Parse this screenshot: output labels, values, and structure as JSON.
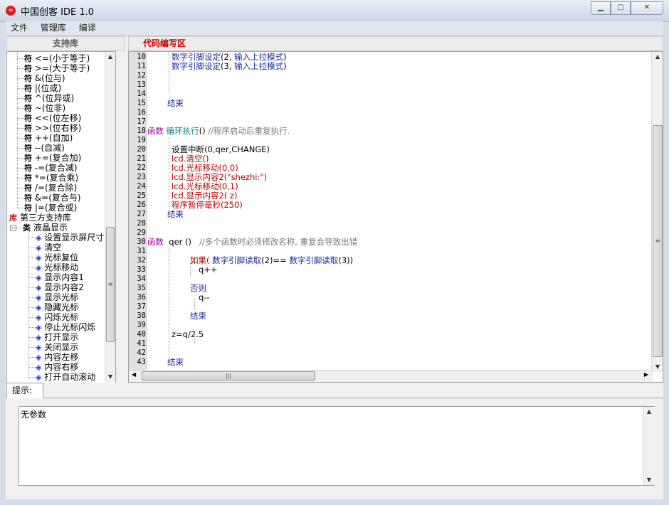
{
  "window": {
    "title": "中国创客 IDE   1.0",
    "icon": "cc-logo-icon"
  },
  "menu": [
    "文件",
    "管理库",
    "编译"
  ],
  "left_panel": {
    "header": "支持库"
  },
  "right_panel": {
    "header": "代码编写区"
  },
  "tree": {
    "operators": [
      {
        "glyph": "符",
        "text": "<=(小于等于)"
      },
      {
        "glyph": "符",
        "text": ">=(大于等于)"
      },
      {
        "glyph": "符",
        "text": "&(位与)"
      },
      {
        "glyph": "符",
        "text": "|(位或)"
      },
      {
        "glyph": "符",
        "text": "^(位异或)"
      },
      {
        "glyph": "符",
        "text": "~(位非)"
      },
      {
        "glyph": "符",
        "text": "<<(位左移)"
      },
      {
        "glyph": "符",
        "text": ">>(位右移)"
      },
      {
        "glyph": "符",
        "text": "++(自加)"
      },
      {
        "glyph": "符",
        "text": "--(自减)"
      },
      {
        "glyph": "符",
        "text": "+=(复合加)"
      },
      {
        "glyph": "符",
        "text": "-=(复合减)"
      },
      {
        "glyph": "符",
        "text": "*=(复合乘)"
      },
      {
        "glyph": "符",
        "text": "/=(复合除)"
      },
      {
        "glyph": "符",
        "text": "&=(复合与)"
      },
      {
        "glyph": "符",
        "text": "|=(复合或)"
      }
    ],
    "library": {
      "glyph": "库",
      "text": "第三方支持库"
    },
    "class": {
      "glyph": "类",
      "text": "液晶显示",
      "expander": "−"
    },
    "functions": [
      "设置显示屏尺寸",
      "清空",
      "光标复位",
      "光标移动",
      "显示内容1",
      "显示内容2",
      "显示光标",
      "隐藏光标",
      "闪烁光标",
      "停止光标闪烁",
      "打开显示",
      "关闭显示",
      "内容左移",
      "内容右移",
      "打开自动滚动"
    ]
  },
  "code": [
    {
      "n": "10",
      "indent": 1,
      "segs": [
        {
          "c": "kw-blue",
          "t": "数字引脚设定"
        },
        {
          "c": "",
          "t": "(2, "
        },
        {
          "c": "kw-blue",
          "t": "输入上拉模式"
        },
        {
          "c": "",
          "t": ")"
        }
      ]
    },
    {
      "n": "11",
      "indent": 1,
      "segs": [
        {
          "c": "kw-blue",
          "t": "数字引脚设定"
        },
        {
          "c": "",
          "t": "(3, "
        },
        {
          "c": "kw-blue",
          "t": "输入上拉模式"
        },
        {
          "c": "",
          "t": ")"
        }
      ]
    },
    {
      "n": "12",
      "indent": 0,
      "segs": []
    },
    {
      "n": "13",
      "indent": 0,
      "segs": []
    },
    {
      "n": "14",
      "indent": 0,
      "segs": []
    },
    {
      "n": "15",
      "indent": 0,
      "segs": [
        {
          "c": "kw-blue",
          "t": "结束"
        }
      ]
    },
    {
      "n": "16",
      "indent": 0,
      "segs": []
    },
    {
      "n": "17",
      "indent": 0,
      "segs": []
    },
    {
      "n": "18",
      "indent": -1,
      "segs": [
        {
          "c": "kw-fn",
          "t": "函数 "
        },
        {
          "c": "kw-teal",
          "t": "循环执行"
        },
        {
          "c": "",
          "t": "() "
        },
        {
          "c": "cm",
          "t": "//程序启动后重复执行."
        }
      ]
    },
    {
      "n": "19",
      "indent": 0,
      "segs": []
    },
    {
      "n": "20",
      "indent": 1,
      "segs": [
        {
          "c": "",
          "t": "设置中断(0,qer,CHANGE)"
        }
      ]
    },
    {
      "n": "21",
      "indent": 1,
      "segs": [
        {
          "c": "kw-red",
          "t": "lcd.清空()"
        }
      ]
    },
    {
      "n": "22",
      "indent": 1,
      "segs": [
        {
          "c": "kw-red",
          "t": "lcd.光标移动(0,0)"
        }
      ]
    },
    {
      "n": "23",
      "indent": 1,
      "segs": [
        {
          "c": "kw-red",
          "t": "lcd.显示内容2(\"shezhi:\")"
        }
      ]
    },
    {
      "n": "24",
      "indent": 1,
      "segs": [
        {
          "c": "kw-red",
          "t": "lcd.光标移动(0,1)"
        }
      ]
    },
    {
      "n": "25",
      "indent": 1,
      "segs": [
        {
          "c": "kw-red",
          "t": "lcd.显示内容2( z)"
        }
      ]
    },
    {
      "n": "26",
      "indent": 1,
      "segs": [
        {
          "c": "kw-red",
          "t": "程序暂停毫秒(250)"
        }
      ]
    },
    {
      "n": "27",
      "indent": 0,
      "segs": [
        {
          "c": "kw-blue",
          "t": "结束"
        }
      ]
    },
    {
      "n": "28",
      "indent": 0,
      "segs": []
    },
    {
      "n": "29",
      "indent": 0,
      "segs": []
    },
    {
      "n": "30",
      "indent": -1,
      "segs": [
        {
          "c": "kw-fn",
          "t": "函数 "
        },
        {
          "c": "",
          "t": " qer () "
        },
        {
          "c": "cm",
          "t": "  //多个函数时必须修改名称, 重复会导致出错"
        }
      ]
    },
    {
      "n": "31",
      "indent": 0,
      "segs": []
    },
    {
      "n": "32",
      "indent": 2,
      "segs": [
        {
          "c": "kw-red",
          "t": "如果( "
        },
        {
          "c": "kw-blue",
          "t": "数字引脚读取"
        },
        {
          "c": "",
          "t": "(2)== "
        },
        {
          "c": "kw-blue",
          "t": "数字引脚读取"
        },
        {
          "c": "",
          "t": "(3))"
        }
      ]
    },
    {
      "n": "33",
      "indent": 3,
      "segs": [
        {
          "c": "",
          "t": "q++"
        }
      ]
    },
    {
      "n": "34",
      "indent": 0,
      "segs": []
    },
    {
      "n": "35",
      "indent": 2,
      "segs": [
        {
          "c": "kw-blue",
          "t": "否则"
        }
      ]
    },
    {
      "n": "36",
      "indent": 3,
      "segs": [
        {
          "c": "",
          "t": "q--"
        }
      ]
    },
    {
      "n": "37",
      "indent": 0,
      "segs": []
    },
    {
      "n": "38",
      "indent": 2,
      "segs": [
        {
          "c": "kw-blue",
          "t": "结束"
        }
      ]
    },
    {
      "n": "39",
      "indent": 0,
      "segs": []
    },
    {
      "n": "40",
      "indent": 1,
      "segs": [
        {
          "c": "",
          "t": "z=q/2.5"
        }
      ]
    },
    {
      "n": "41",
      "indent": 0,
      "segs": []
    },
    {
      "n": "42",
      "indent": 0,
      "segs": []
    },
    {
      "n": "43",
      "indent": 0,
      "segs": [
        {
          "c": "kw-blue",
          "t": "结束"
        }
      ]
    }
  ],
  "hint": {
    "tab_label": "提示:",
    "text": "无参数"
  },
  "icons": {
    "minimize": "minimize-icon",
    "maximize": "maximize-icon",
    "close": "close-icon"
  }
}
